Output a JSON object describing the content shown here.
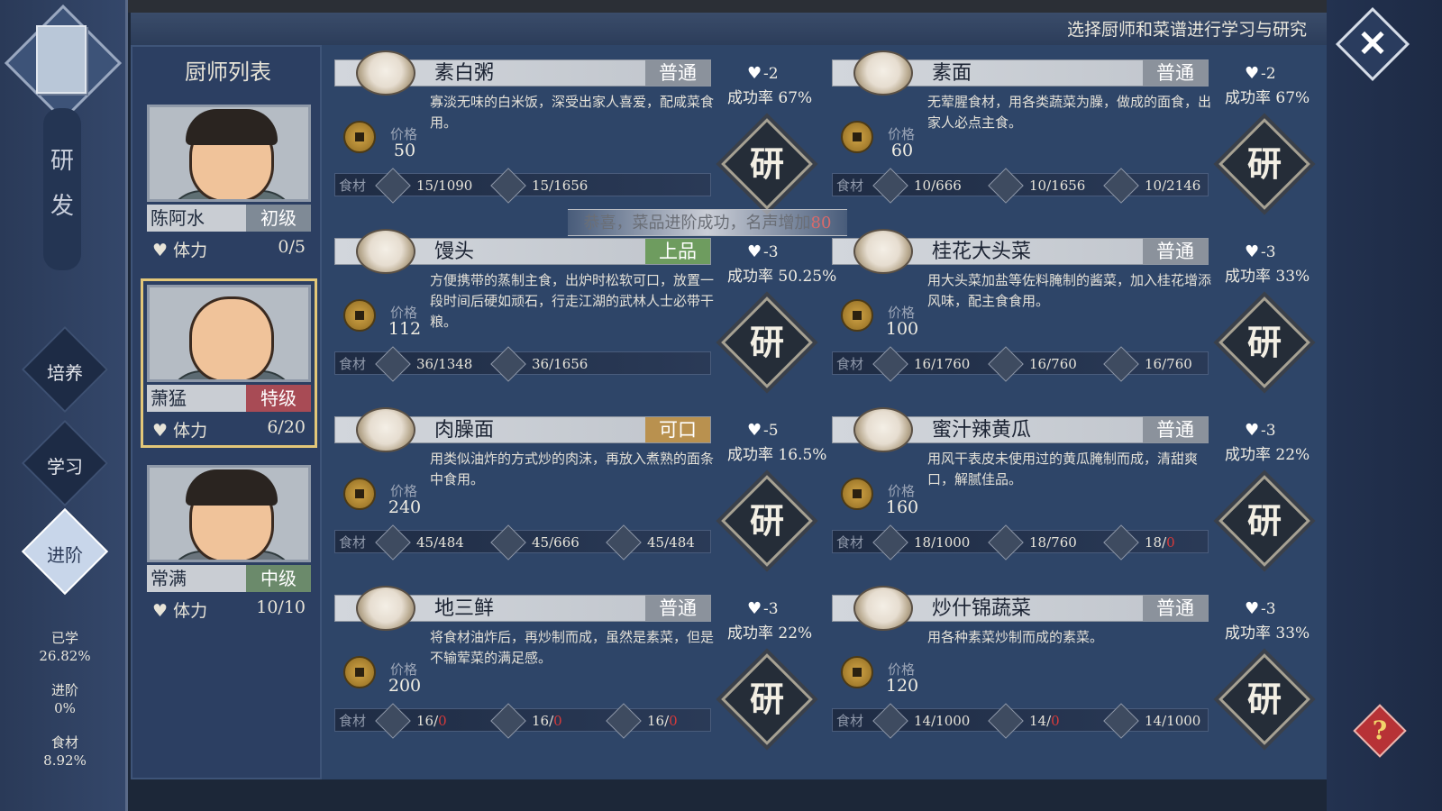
{
  "header": {
    "hint": "选择厨师和菜谱进行学习与研究"
  },
  "leftnav": {
    "tab_research": [
      "研",
      "发"
    ],
    "items": [
      {
        "label": "培养"
      },
      {
        "label": "学习"
      },
      {
        "label": "进阶"
      }
    ],
    "stats": [
      {
        "label": "已学",
        "value": "26.82%"
      },
      {
        "label": "进阶",
        "value": "0%"
      },
      {
        "label": "食材",
        "value": "8.92%"
      }
    ]
  },
  "chef_list": {
    "title": "厨师列表",
    "hp_label": "体力",
    "chefs": [
      {
        "name": "陈阿水",
        "rank": "初级",
        "hp": "0/5"
      },
      {
        "name": "萧猛",
        "rank": "特级",
        "hp": "6/20"
      },
      {
        "name": "常满",
        "rank": "中级",
        "hp": "10/10"
      }
    ]
  },
  "labels": {
    "price": "价格",
    "ingredients": "食材",
    "rate_prefix": "成功率",
    "research": "研"
  },
  "toast": {
    "text": "恭喜，菜品进阶成功，名声增加",
    "value": "80"
  },
  "recipes": [
    {
      "name": "素白粥",
      "grade": "普通",
      "desc": "寡淡无味的白米饭，深受出家人喜爱，配咸菜食用。",
      "price": "50",
      "cost": "-2",
      "rate": "67%",
      "ingredients": [
        {
          "have": "15",
          "need": "1090"
        },
        {
          "have": "15",
          "need": "1656"
        }
      ]
    },
    {
      "name": "素面",
      "grade": "普通",
      "desc": "无荤腥食材，用各类蔬菜为臊，做成的面食，出家人必点主食。",
      "price": "60",
      "cost": "-2",
      "rate": "67%",
      "ingredients": [
        {
          "have": "10",
          "need": "666"
        },
        {
          "have": "10",
          "need": "1656"
        },
        {
          "have": "10",
          "need": "2146"
        }
      ]
    },
    {
      "name": "馒头",
      "grade": "上品",
      "desc": "方便携带的蒸制主食，出炉时松软可口，放置一段时间后硬如顽石，行走江湖的武林人士必带干粮。",
      "price": "112",
      "cost": "-3",
      "rate": "50.25%",
      "ingredients": [
        {
          "have": "36",
          "need": "1348"
        },
        {
          "have": "36",
          "need": "1656"
        }
      ]
    },
    {
      "name": "桂花大头菜",
      "grade": "普通",
      "desc": "用大头菜加盐等佐料腌制的酱菜，加入桂花增添风味，配主食食用。",
      "price": "100",
      "cost": "-3",
      "rate": "33%",
      "ingredients": [
        {
          "have": "16",
          "need": "1760"
        },
        {
          "have": "16",
          "need": "760"
        },
        {
          "have": "16",
          "need": "760"
        }
      ]
    },
    {
      "name": "肉臊面",
      "grade": "可口",
      "desc": "用类似油炸的方式炒的肉沫，再放入煮熟的面条中食用。",
      "price": "240",
      "cost": "-5",
      "rate": "16.5%",
      "ingredients": [
        {
          "have": "45",
          "need": "484"
        },
        {
          "have": "45",
          "need": "666"
        },
        {
          "have": "45",
          "need": "484"
        }
      ]
    },
    {
      "name": "蜜汁辣黄瓜",
      "grade": "普通",
      "desc": "用风干表皮未使用过的黄瓜腌制而成，清甜爽口，解腻佳品。",
      "price": "160",
      "cost": "-3",
      "rate": "22%",
      "ingredients": [
        {
          "have": "18",
          "need": "1000"
        },
        {
          "have": "18",
          "need": "760"
        },
        {
          "have": "18",
          "need": "0"
        }
      ]
    },
    {
      "name": "地三鲜",
      "grade": "普通",
      "desc": "将食材油炸后，再炒制而成，虽然是素菜，但是不输荤菜的满足感。",
      "price": "200",
      "cost": "-3",
      "rate": "22%",
      "ingredients": [
        {
          "have": "16",
          "need": "0"
        },
        {
          "have": "16",
          "need": "0"
        },
        {
          "have": "16",
          "need": "0"
        }
      ]
    },
    {
      "name": "炒什锦蔬菜",
      "grade": "普通",
      "desc": "用各种素菜炒制而成的素菜。",
      "price": "120",
      "cost": "-3",
      "rate": "33%",
      "ingredients": [
        {
          "have": "14",
          "need": "1000"
        },
        {
          "have": "14",
          "need": "0"
        },
        {
          "have": "14",
          "need": "1000"
        }
      ]
    }
  ]
}
